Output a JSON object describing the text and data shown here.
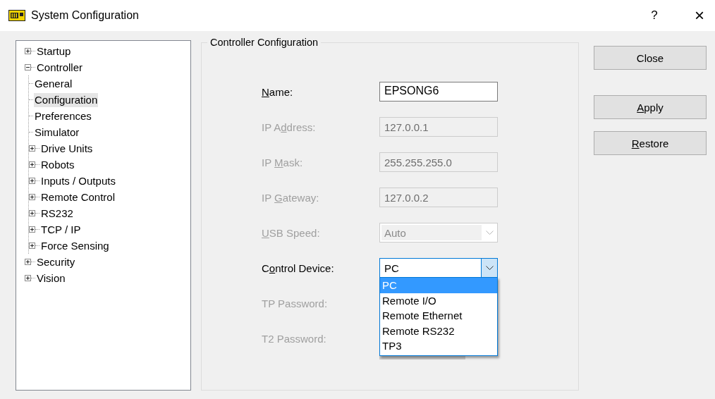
{
  "window": {
    "title": "System Configuration",
    "help": "?",
    "close": "×"
  },
  "tree": [
    {
      "label": "Startup",
      "expanded": false,
      "selected": false
    },
    {
      "label": "Controller",
      "expanded": true,
      "selected": false,
      "children": [
        {
          "label": "General",
          "selected": false
        },
        {
          "label": "Configuration",
          "selected": true
        },
        {
          "label": "Preferences",
          "selected": false
        },
        {
          "label": "Simulator",
          "selected": false
        },
        {
          "label": "Drive Units",
          "expanded": false,
          "selected": false
        },
        {
          "label": "Robots",
          "expanded": false,
          "selected": false
        },
        {
          "label": "Inputs / Outputs",
          "expanded": false,
          "selected": false
        },
        {
          "label": "Remote Control",
          "expanded": false,
          "selected": false
        },
        {
          "label": "RS232",
          "expanded": false,
          "selected": false
        },
        {
          "label": "TCP / IP",
          "expanded": false,
          "selected": false
        },
        {
          "label": "Force Sensing",
          "expanded": false,
          "selected": false
        }
      ]
    },
    {
      "label": "Security",
      "expanded": false,
      "selected": false
    },
    {
      "label": "Vision",
      "expanded": false,
      "selected": false
    }
  ],
  "group": {
    "title": "Controller Configuration",
    "fields": [
      {
        "label": {
          "key": "N",
          "rest": "ame:"
        },
        "kind": "text",
        "disabled": false,
        "value": "EPSONG6"
      },
      {
        "label": {
          "lead": "IP A",
          "key": "d",
          "rest": "dress:"
        },
        "kind": "text",
        "disabled": true,
        "value": "127.0.0.1"
      },
      {
        "label": {
          "lead": "IP ",
          "key": "M",
          "rest": "ask:"
        },
        "kind": "text",
        "disabled": true,
        "value": "255.255.255.0"
      },
      {
        "label": {
          "lead": "IP ",
          "key": "G",
          "rest": "ateway:"
        },
        "kind": "text",
        "disabled": true,
        "value": "127.0.0.2"
      },
      {
        "label": {
          "key": "U",
          "rest": "SB Speed:"
        },
        "kind": "combo",
        "disabled": true,
        "value": "Auto",
        "open": false
      },
      {
        "label": {
          "lead": "C",
          "key": "o",
          "rest": "ntrol Device:"
        },
        "kind": "combo",
        "disabled": false,
        "value": "PC",
        "open": true,
        "options": [
          {
            "label": "PC",
            "selected": true
          },
          {
            "label": "Remote I/O",
            "selected": false
          },
          {
            "label": "Remote Ethernet",
            "selected": false
          },
          {
            "label": "Remote RS232",
            "selected": false
          },
          {
            "label": "TP3",
            "selected": false
          }
        ]
      },
      {
        "label": {
          "lead": "TP Password:"
        },
        "kind": "hidden",
        "disabled": true
      },
      {
        "label": {
          "lead": "T2 Password:"
        },
        "kind": "password",
        "disabled": true
      }
    ]
  },
  "buttons": [
    {
      "label": {
        "lead": "Close"
      }
    },
    {
      "label": {
        "key": "A",
        "rest": "pply"
      }
    },
    {
      "label": {
        "key": "R",
        "rest": "estore"
      }
    }
  ]
}
